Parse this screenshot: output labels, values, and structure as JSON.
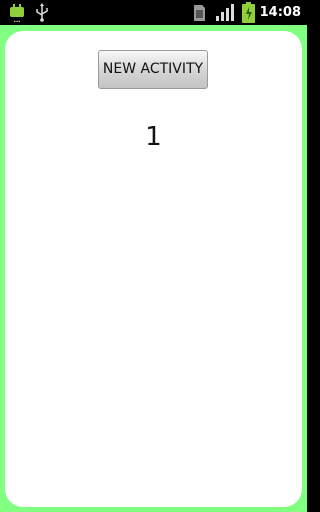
{
  "status_bar": {
    "left_icons": [
      "android-debug-icon",
      "usb-icon"
    ],
    "right_icons": [
      "sim-card-icon",
      "signal-strength-icon",
      "battery-charging-icon"
    ],
    "time": "14:08"
  },
  "activity": {
    "background_color": "#80ff80",
    "content_background": "#ffffff",
    "button_label": "NEW ACTIVITY",
    "counter": "1"
  }
}
